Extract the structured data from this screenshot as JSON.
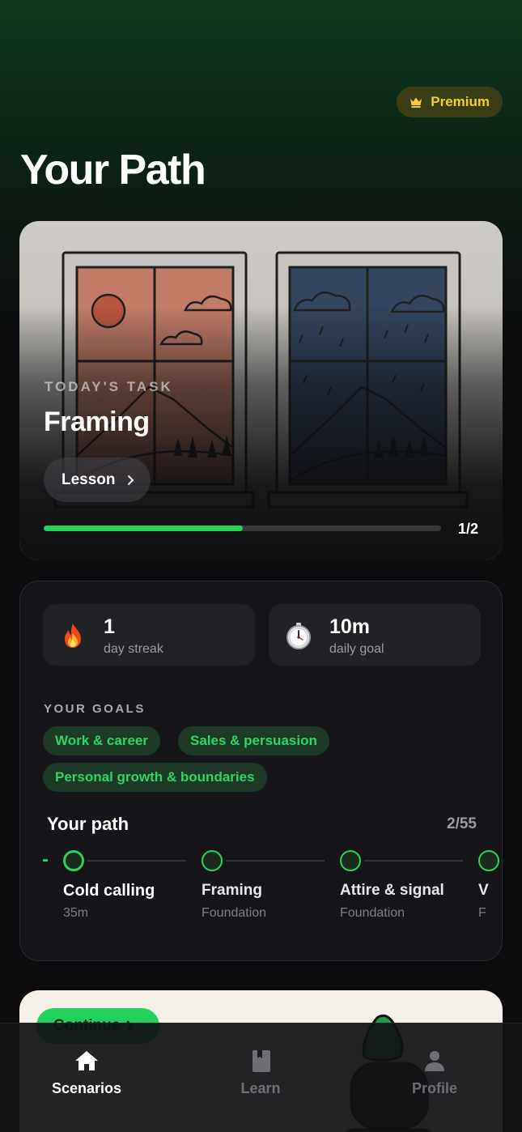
{
  "header": {
    "premium_label": "Premium",
    "page_title": "Your Path"
  },
  "today_task": {
    "eyebrow": "TODAY'S TASK",
    "title": "Framing",
    "lesson_label": "Lesson",
    "progress_fraction": 0.5,
    "progress_text": "1/2"
  },
  "stats": [
    {
      "value": "1",
      "label": "day streak",
      "icon": "fire-icon"
    },
    {
      "value": "10m",
      "label": "daily goal",
      "icon": "stopwatch-icon"
    }
  ],
  "goals": {
    "label": "YOUR GOALS",
    "chips": [
      "Work & career",
      "Sales & persuasion",
      "Personal growth & boundaries"
    ]
  },
  "path": {
    "title": "Your path",
    "count": "2/55",
    "steps": [
      {
        "name": "Cold calling",
        "sub": "35m"
      },
      {
        "name": "Framing",
        "sub": "Foundation"
      },
      {
        "name": "Attire & signal",
        "sub": "Foundation"
      },
      {
        "name": "V",
        "sub": "F"
      }
    ]
  },
  "promo": {
    "continue_label": "Continue"
  },
  "tabbar": {
    "items": [
      "Scenarios",
      "Learn",
      "Profile"
    ]
  },
  "colors": {
    "accent": "#26d45a",
    "premium": "#f4cf2a",
    "background": "#0c0c0e"
  }
}
